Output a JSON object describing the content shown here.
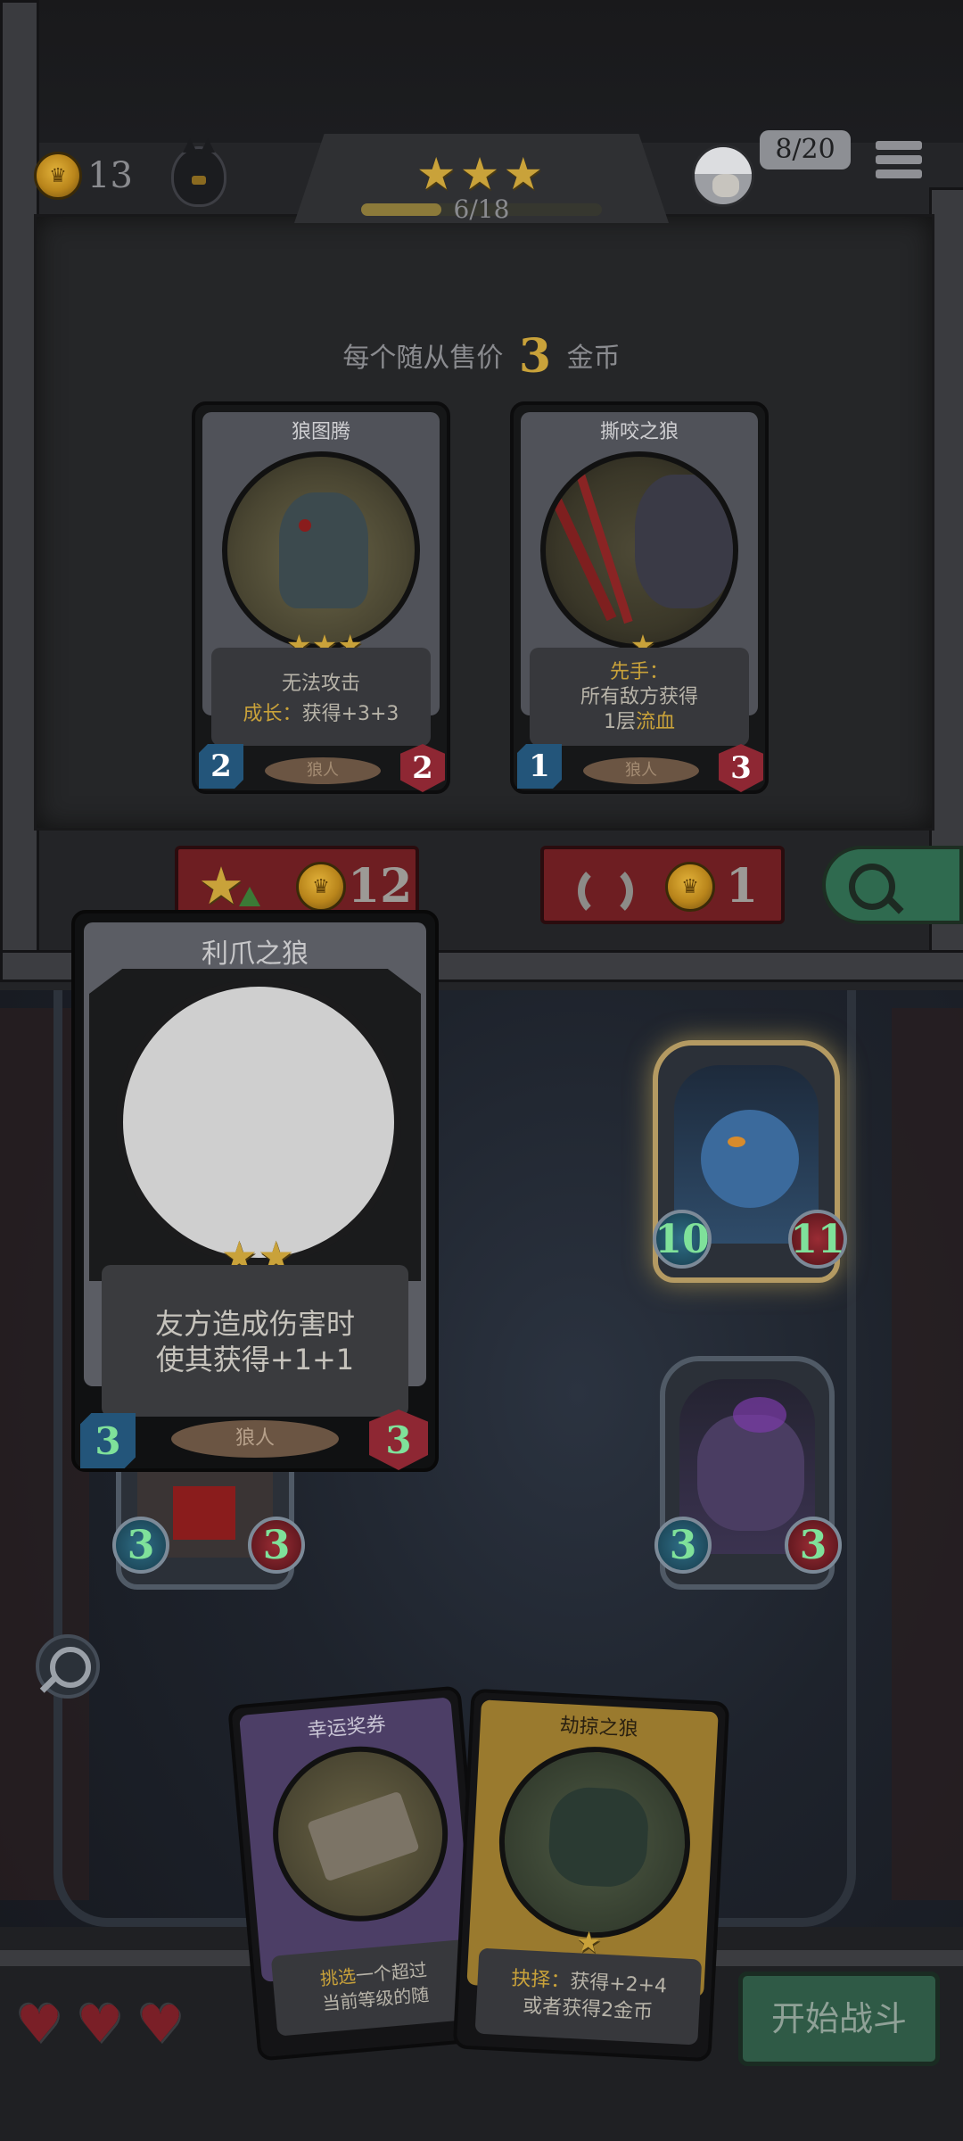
{
  "header": {
    "gold": "13",
    "stars": 3,
    "progress_text": "6/18",
    "progress_fraction": 0.333,
    "opponents": "8/20"
  },
  "shop": {
    "sell_text_before": "每个随从售价",
    "sell_price": "3",
    "sell_text_after": "金币",
    "cards": [
      {
        "name": "狼图腾",
        "stars": 3,
        "desc_line1": "无法攻击",
        "desc_keyword": "成长：",
        "desc_line2": "获得+3+3",
        "tribe": "狼人",
        "attack": "2",
        "health": "2"
      },
      {
        "name": "撕咬之狼",
        "stars": 1,
        "desc_keyword": "先手：",
        "desc_line1": "所有敌方获得",
        "desc_line2_prefix": "1层",
        "desc_line2_keyword": "流血",
        "tribe": "狼人",
        "attack": "1",
        "health": "3"
      }
    ],
    "upgrade_cost": "12",
    "refresh_cost": "1"
  },
  "preview_card": {
    "name": "利爪之狼",
    "stars": 2,
    "desc_line1": "友方造成伤害时",
    "desc_line2": "使其获得+1+1",
    "tribe": "狼人",
    "attack": "3",
    "health": "3"
  },
  "board": {
    "minions": [
      {
        "attack": "10",
        "health": "11"
      },
      {
        "attack": "3",
        "health": "3"
      },
      {
        "attack": "3",
        "health": "3"
      }
    ]
  },
  "hand": {
    "cards": [
      {
        "name": "幸运奖券",
        "desc_keyword": "挑选",
        "desc_line1": "一个超过",
        "desc_line2": "当前等级的随"
      },
      {
        "name": "劫掠之狼",
        "stars": 1,
        "desc_keyword": "抉择：",
        "desc_line1": "获得+2+4",
        "desc_line2": "或者获得2金币"
      }
    ]
  },
  "lives": 3,
  "start_battle_label": "开始战斗",
  "colors": {
    "gold": "#c9a23a",
    "keyword": "#c9a23a",
    "attack_blue": "#23557a",
    "health_red": "#8e2733",
    "start_button": "#2f6a4f"
  }
}
